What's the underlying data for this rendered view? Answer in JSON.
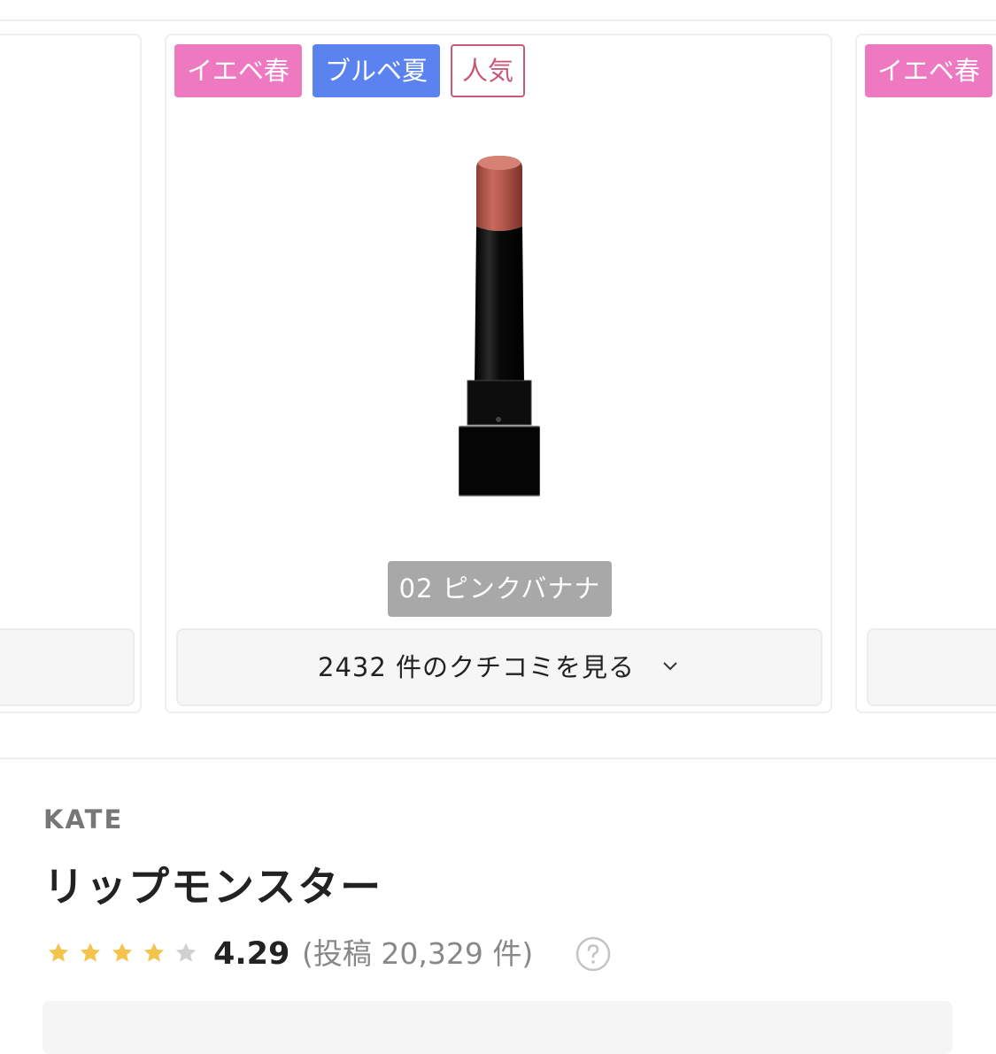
{
  "carousel": {
    "left_card": {},
    "center_card": {
      "tags": [
        "イエベ春",
        "ブルベ夏",
        "人気"
      ],
      "shade_label": "02 ピンクバナナ",
      "reviews_button_label": "2432 件のクチコミを見る"
    },
    "right_card": {
      "tags": [
        "イエベ春"
      ]
    }
  },
  "product": {
    "brand": "KATE",
    "name": "リップモンスター",
    "rating": {
      "filled_stars": 4,
      "total_stars": 5,
      "value": "4.29",
      "post_count_text": "(投稿 20,329 件)"
    }
  },
  "colors": {
    "tag_spring": "#ee79c1",
    "tag_summer": "#5b83f0",
    "tag_popular_border": "#c85a78",
    "star_filled": "#f4c44e",
    "star_empty": "#d0d0d0"
  }
}
